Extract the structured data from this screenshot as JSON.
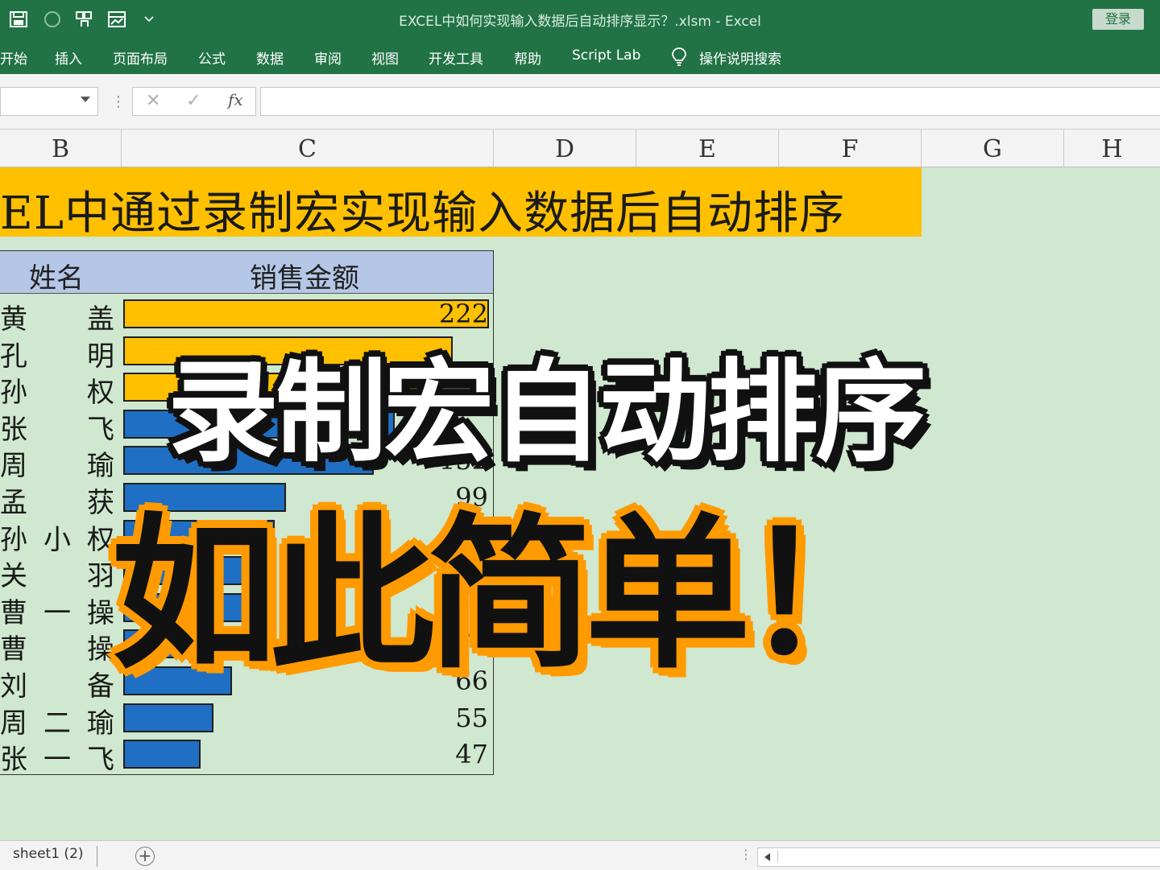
{
  "window": {
    "title": "EXCEL中如何实现输入数据后自动排序显示？.xlsm  -  Excel",
    "login_label": "登录"
  },
  "quick_access": {
    "icons": [
      "save-icon",
      "autosave-icon",
      "touch-mode-icon",
      "form-icon",
      "customize-dropdown-icon"
    ]
  },
  "ribbon": {
    "tabs": [
      "开始",
      "插入",
      "页面布局",
      "公式",
      "数据",
      "审阅",
      "视图",
      "开发工具",
      "帮助",
      "Script Lab"
    ],
    "search_label": "操作说明搜索"
  },
  "formula_bar": {
    "cancel_glyph": "✕",
    "enter_glyph": "✓",
    "fx_label": "fx",
    "value": ""
  },
  "columns": [
    "B",
    "C",
    "D",
    "E",
    "F",
    "G",
    "H"
  ],
  "sheet": {
    "title": "EL中通过录制宏实现输入数据后自动排序",
    "table_headers": {
      "name": "姓名",
      "amount": "销售金额"
    },
    "rows": [
      {
        "name": [
          "黄",
          "",
          "盖"
        ],
        "value": "222",
        "amount": 222,
        "color": "#ffc000"
      },
      {
        "name": [
          "孔",
          "",
          "明"
        ],
        "value": "",
        "amount": 200,
        "color": "#ffc000"
      },
      {
        "name": [
          "孙",
          "",
          "权"
        ],
        "value": "",
        "amount": 180,
        "color": "#ffc000"
      },
      {
        "name": [
          "张",
          "",
          "飞"
        ],
        "value": "",
        "amount": 165,
        "color": "#1f6fc4"
      },
      {
        "name": [
          "周",
          "",
          "瑜"
        ],
        "value": "152",
        "amount": 152,
        "color": "#1f6fc4"
      },
      {
        "name": [
          "孟",
          "",
          "获"
        ],
        "value": "99",
        "amount": 99,
        "color": "#1f6fc4"
      },
      {
        "name": [
          "孙",
          "小",
          "权"
        ],
        "value": "",
        "amount": 92,
        "color": "#1f6fc4"
      },
      {
        "name": [
          "关",
          "",
          "羽"
        ],
        "value": "89",
        "amount": 89,
        "color": "#1f6fc4"
      },
      {
        "name": [
          "曹",
          "一",
          "操"
        ],
        "value": "",
        "amount": 84,
        "color": "#1f6fc4"
      },
      {
        "name": [
          "曹",
          "",
          "操"
        ],
        "value": "78",
        "amount": 78,
        "color": "#1f6fc4"
      },
      {
        "name": [
          "刘",
          "",
          "备"
        ],
        "value": "66",
        "amount": 66,
        "color": "#1f6fc4"
      },
      {
        "name": [
          "周",
          "二",
          "瑜"
        ],
        "value": "55",
        "amount": 55,
        "color": "#1f6fc4"
      },
      {
        "name": [
          "张",
          "一",
          "飞"
        ],
        "value": "47",
        "amount": 47,
        "color": "#1f6fc4"
      }
    ]
  },
  "overlay": {
    "line1": "录制宏自动排序",
    "line2": "如此简单！",
    "line1_color": "#ffffff",
    "line2_color": "#111111",
    "line2_outline": "#ff9a00"
  },
  "statusbar": {
    "sheet_tab": "sheet1 (2)",
    "add_sheet_glyph": "+"
  },
  "colors": {
    "ribbon": "#217346",
    "sheet_bg": "#cfe8cf",
    "banner": "#ffc000",
    "table_header": "#b4c7e7"
  }
}
